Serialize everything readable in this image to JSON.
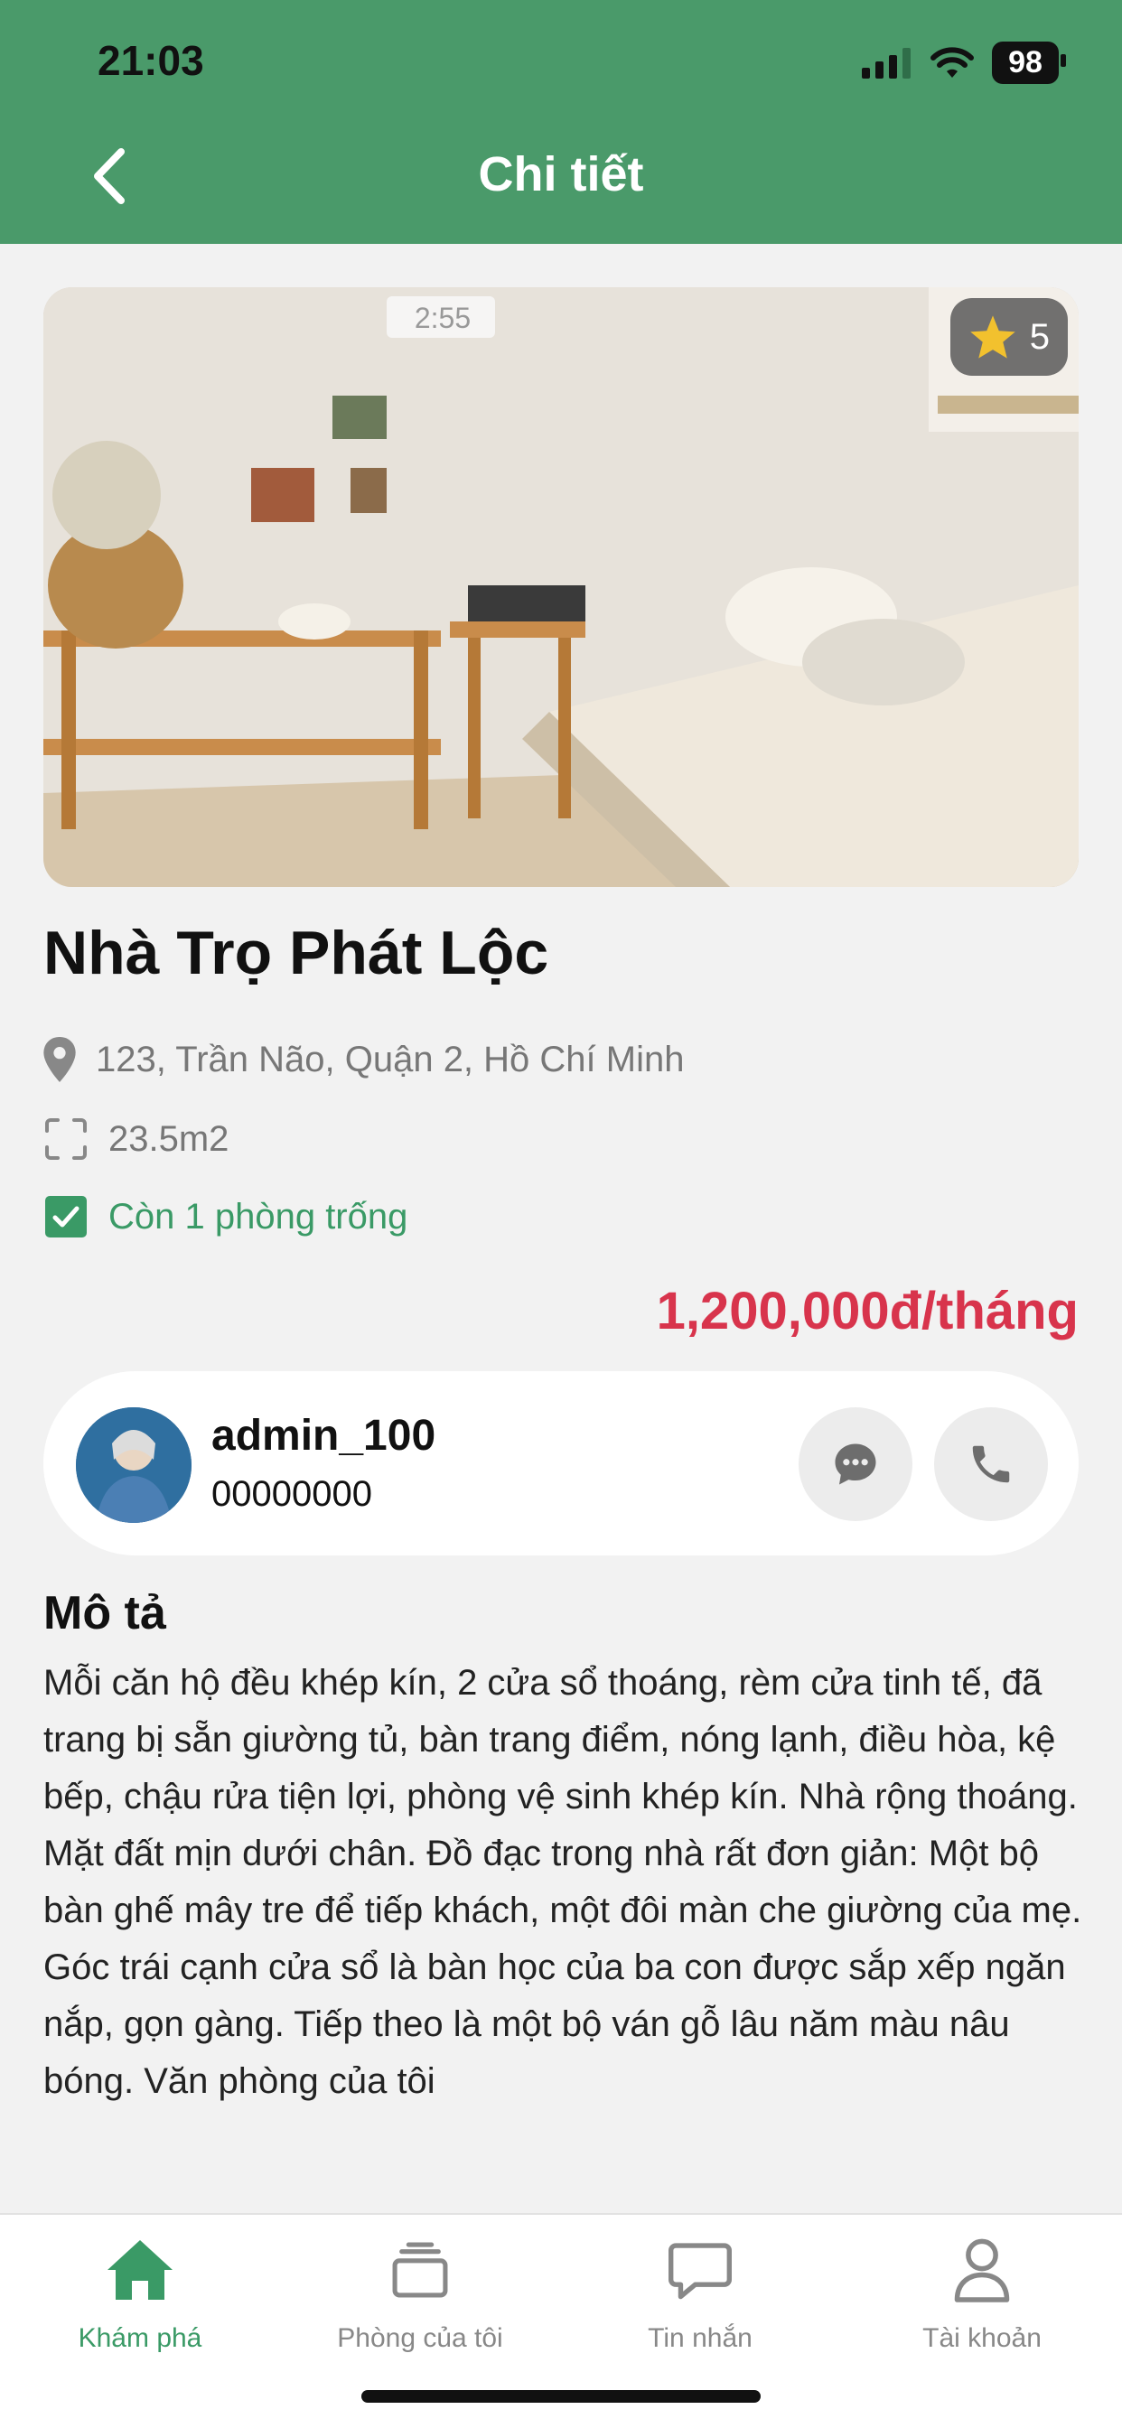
{
  "status_bar": {
    "time": "21:03",
    "battery": "98"
  },
  "header": {
    "title": "Chi tiết"
  },
  "listing": {
    "rating": "5",
    "title": "Nhà Trọ Phát Lộc",
    "address": "123, Trần Não, Quận 2, Hồ Chí Minh",
    "area": "23.5m2",
    "availability": "Còn 1 phòng trống",
    "price": "1,200,000đ/tháng",
    "photo_clock_text": "2:55"
  },
  "owner": {
    "name": "admin_100",
    "phone": "00000000"
  },
  "description": {
    "heading": "Mô tả",
    "text": "Mỗi căn hộ đều khép kín, 2 cửa sổ thoáng, rèm cửa tinh tế, đã trang bị sẵn giường tủ, bàn trang điểm, nóng lạnh, điều hòa, kệ bếp, chậu rửa tiện lợi, phòng vệ sinh khép kín. Nhà rộng thoáng. Mặt đất mịn dưới chân. Đồ đạc trong nhà rất đơn giản: Một bộ bàn ghế mây tre để tiếp khách, một đôi màn che giường của mẹ. Góc trái cạnh cửa sổ là bàn học của ba con được sắp xếp ngăn nắp, gọn gàng. Tiếp theo là một bộ ván gỗ lâu năm màu nâu bóng. Văn phòng của tôi"
  },
  "tabs": [
    {
      "label": "Khám phá",
      "icon": "home-icon",
      "active": true
    },
    {
      "label": "Phòng của tôi",
      "icon": "rooms-icon",
      "active": false
    },
    {
      "label": "Tin nhắn",
      "icon": "message-icon",
      "active": false
    },
    {
      "label": "Tài khoản",
      "icon": "account-icon",
      "active": false
    }
  ],
  "colors": {
    "brand_green": "#4a9a6a",
    "price_red": "#d8344c",
    "star_yellow": "#f2c12e"
  }
}
